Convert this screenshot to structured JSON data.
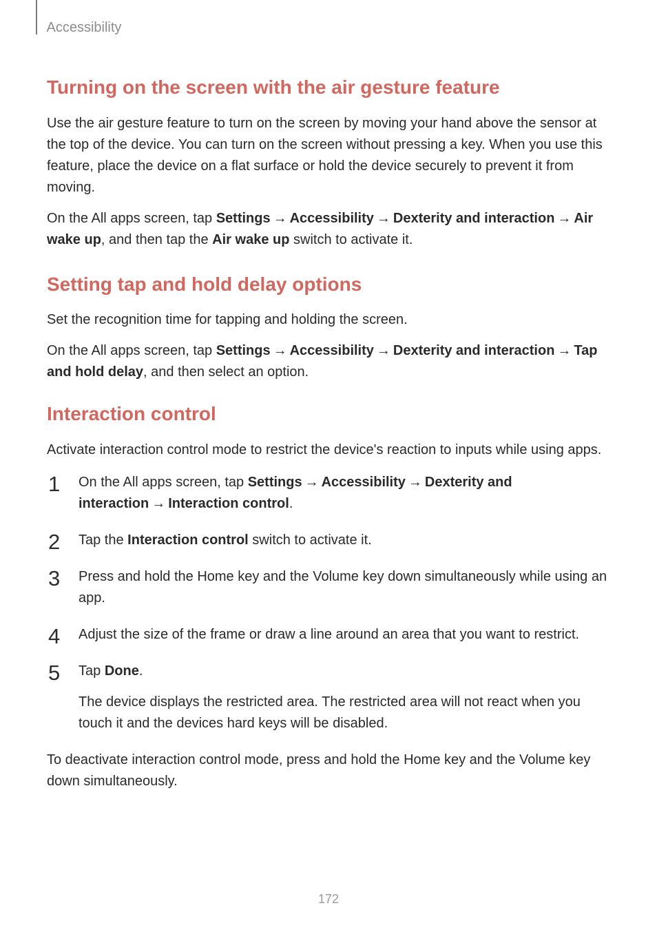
{
  "header": {
    "breadcrumb": "Accessibility"
  },
  "section1": {
    "title": "Turning on the screen with the air gesture feature",
    "para1": "Use the air gesture feature to turn on the screen by moving your hand above the sensor at the top of the device. You can turn on the screen without pressing a key. When you use this feature, place the device on a flat surface or hold the device securely to prevent it from moving.",
    "para2_pre": "On the All apps screen, tap ",
    "settings": "Settings",
    "accessibility": "Accessibility",
    "dexterity": "Dexterity and interaction",
    "airwake": "Air wake up",
    "para2_mid": ", and then tap the ",
    "airwake2": "Air wake up",
    "para2_end": " switch to activate it."
  },
  "section2": {
    "title": "Setting tap and hold delay options",
    "para1": "Set the recognition time for tapping and holding the screen.",
    "para2_pre": "On the All apps screen, tap ",
    "settings": "Settings",
    "accessibility": "Accessibility",
    "dexterity": "Dexterity and interaction",
    "taphold": "Tap and hold delay",
    "para2_end": ", and then select an option."
  },
  "section3": {
    "title": "Interaction control",
    "para1": "Activate interaction control mode to restrict the device's reaction to inputs while using apps.",
    "step1_pre": "On the All apps screen, tap ",
    "settings": "Settings",
    "accessibility": "Accessibility",
    "dexterity": "Dexterity and interaction",
    "interaction": "Interaction control",
    "step1_end": ".",
    "step2_pre": "Tap the ",
    "interaction2": "Interaction control",
    "step2_end": " switch to activate it.",
    "step3": "Press and hold the Home key and the Volume key down simultaneously while using an app.",
    "step4": "Adjust the size of the frame or draw a line around an area that you want to restrict.",
    "step5_pre": "Tap ",
    "done": "Done",
    "step5_end": ".",
    "step5_follow": "The device displays the restricted area. The restricted area will not react when you touch it and the devices hard keys will be disabled.",
    "closing": "To deactivate interaction control mode, press and hold the Home key and the Volume key down simultaneously."
  },
  "arrow": "→",
  "pagenum": "172"
}
